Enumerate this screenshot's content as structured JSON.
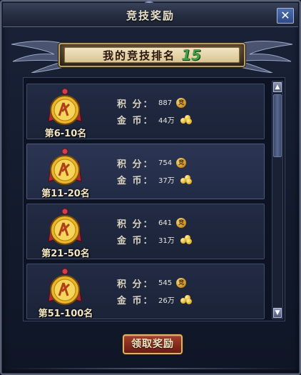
{
  "window": {
    "title": "竞技奖励",
    "close_label": "✕"
  },
  "banner": {
    "label": "我的竞技排名",
    "value": "15"
  },
  "stat_labels": {
    "points": "积 分：",
    "gold": "金 币："
  },
  "rewards": [
    {
      "rank": "第6-10名",
      "points": "887",
      "gold": "44万"
    },
    {
      "rank": "第11-20名",
      "points": "754",
      "gold": "37万"
    },
    {
      "rank": "第21-50名",
      "points": "641",
      "gold": "31万"
    },
    {
      "rank": "第51-100名",
      "points": "545",
      "gold": "26万"
    }
  ],
  "icons": {
    "points_icon": "竞",
    "gold_icon": "gold-ingot-icon",
    "scroll_up": "▲",
    "scroll_down": "▼"
  },
  "claim_button": {
    "label": "领取奖励"
  },
  "colors": {
    "accent_gold": "#d8b36a",
    "rank_green": "#3fa046",
    "button_red": "#8a2a1a"
  }
}
